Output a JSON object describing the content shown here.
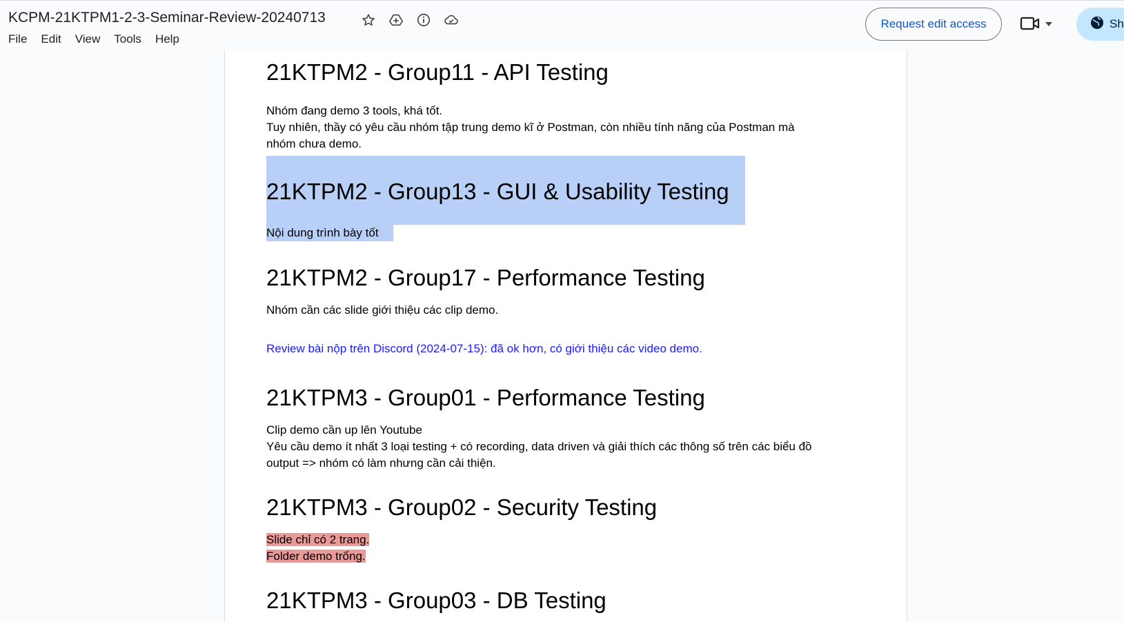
{
  "header": {
    "title": "KCPM-21KTPM1-2-3-Seminar-Review-20240713",
    "menu": [
      "File",
      "Edit",
      "View",
      "Tools",
      "Help"
    ],
    "request_edit_label": "Request edit access",
    "share_label": "Sh"
  },
  "doc": {
    "sections": [
      {
        "heading": "21KTPM2 - Group11 - API Testing",
        "lines": [
          "Nhóm đang demo 3 tools, khá tốt.",
          "Tuy nhiên, thầy có yêu cầu nhóm tập trung demo kĩ ở Postman, còn nhiều tính năng của Postman mà",
          "nhóm chưa demo."
        ]
      },
      {
        "heading": "21KTPM2 - Group13 - GUI & Usability Testing",
        "lines": [
          "Nội dung trình bày tốt"
        ]
      },
      {
        "heading": "21KTPM2 - Group17 - Performance Testing",
        "lines": [
          "Nhóm cần các slide giới thiệu các clip demo."
        ],
        "review": "Review bài nộp trên Discord (2024-07-15): đã ok hơn, có giới thiệu các video demo."
      },
      {
        "heading": "21KTPM3 - Group01 - Performance Testing",
        "lines": [
          "Clip demo cần up lên Youtube",
          "Yêu cầu demo ít nhất 3 loại testing + có recording, data driven và giải thích các thông số trên các biểu đồ",
          "output => nhóm có làm nhưng cần cải thiện."
        ]
      },
      {
        "heading": "21KTPM3 - Group02 - Security Testing",
        "lines": [
          "Slide chỉ có 2 trang.",
          "Folder demo trống."
        ]
      },
      {
        "heading": "21KTPM3 - Group03 - DB Testing",
        "lines": []
      }
    ]
  },
  "colors": {
    "selection": "#b8cff7",
    "red_highlight": "#ea9999",
    "link": "#1a1aff",
    "accent": "#0b57d0"
  }
}
